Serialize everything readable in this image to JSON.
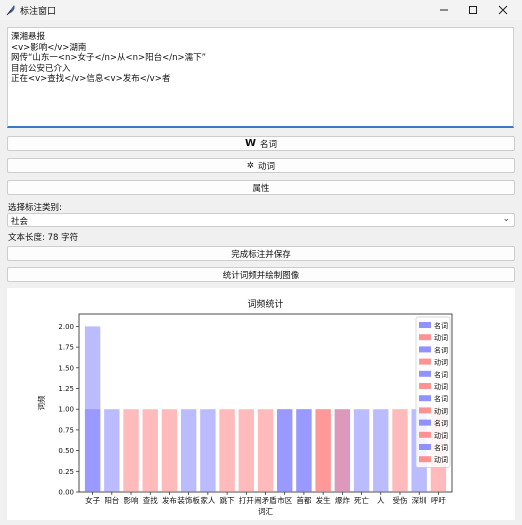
{
  "window": {
    "title": "标注窗口"
  },
  "editor": {
    "lines": [
      "溧湘悬报",
      "<v>影响</v>湖南",
      "网传“山东一<n>女子</n>从<n>阳台</n>濡下”",
      "目前公安已介入",
      "正在<v>查找</v>信息<v>发布</v>者"
    ]
  },
  "buttons": {
    "noun": {
      "icon": "W",
      "label": "名词"
    },
    "verb": {
      "icon": "✲",
      "label": "动词"
    },
    "attr": {
      "label": "属性"
    },
    "save": {
      "label": "完成标注并保存"
    },
    "stats": {
      "label": "统计词频并绘制图像"
    }
  },
  "category": {
    "label": "选择标注类别:",
    "selected": "社会"
  },
  "length": {
    "text": "文本长度: 78 字符"
  },
  "colors": {
    "noun": "#7777ff",
    "verb": "#ff7777"
  },
  "chart_data": {
    "type": "bar",
    "title": "词频统计",
    "xlabel": "词汇",
    "ylabel": "词频",
    "ylim": [
      0,
      2.15
    ],
    "yticks": [
      "0.00",
      "0.25",
      "0.50",
      "0.75",
      "1.00",
      "1.25",
      "1.50",
      "1.75",
      "2.00"
    ],
    "categories": [
      "女子",
      "阳台",
      "影响",
      "查找",
      "发布",
      "装饰板",
      "家人",
      "跳下",
      "打开",
      "闹矛盾",
      "市区",
      "首都",
      "发生",
      "爆炸",
      "死亡",
      "人",
      "受伤",
      "深圳",
      "呼吁"
    ],
    "bars": [
      {
        "cat": "女子",
        "layers": [
          {
            "pos": "n",
            "value": 2.0
          },
          {
            "pos": "n",
            "value": 1.0
          }
        ]
      },
      {
        "cat": "阳台",
        "layers": [
          {
            "pos": "n",
            "value": 1.0
          }
        ]
      },
      {
        "cat": "影响",
        "layers": [
          {
            "pos": "v",
            "value": 1.0
          }
        ]
      },
      {
        "cat": "查找",
        "layers": [
          {
            "pos": "v",
            "value": 1.0
          }
        ]
      },
      {
        "cat": "发布",
        "layers": [
          {
            "pos": "v",
            "value": 1.0
          }
        ]
      },
      {
        "cat": "装饰板",
        "layers": [
          {
            "pos": "n",
            "value": 1.0
          }
        ]
      },
      {
        "cat": "家人",
        "layers": [
          {
            "pos": "n",
            "value": 1.0
          }
        ]
      },
      {
        "cat": "跳下",
        "layers": [
          {
            "pos": "v",
            "value": 1.0
          }
        ]
      },
      {
        "cat": "打开",
        "layers": [
          {
            "pos": "v",
            "value": 1.0
          }
        ]
      },
      {
        "cat": "闹矛盾",
        "layers": [
          {
            "pos": "v",
            "value": 1.0
          }
        ]
      },
      {
        "cat": "市区",
        "layers": [
          {
            "pos": "n",
            "value": 1.0
          },
          {
            "pos": "n",
            "value": 1.0
          }
        ]
      },
      {
        "cat": "首都",
        "layers": [
          {
            "pos": "n",
            "value": 1.0
          },
          {
            "pos": "n",
            "value": 1.0
          }
        ]
      },
      {
        "cat": "发生",
        "layers": [
          {
            "pos": "v",
            "value": 1.0
          },
          {
            "pos": "v",
            "value": 1.0
          }
        ]
      },
      {
        "cat": "爆炸",
        "layers": [
          {
            "pos": "n",
            "value": 1.0
          },
          {
            "pos": "v",
            "value": 1.0
          }
        ]
      },
      {
        "cat": "死亡",
        "layers": [
          {
            "pos": "n",
            "value": 1.0
          }
        ]
      },
      {
        "cat": "人",
        "layers": [
          {
            "pos": "n",
            "value": 1.0
          }
        ]
      },
      {
        "cat": "受伤",
        "layers": [
          {
            "pos": "v",
            "value": 1.0
          }
        ]
      },
      {
        "cat": "深圳",
        "layers": [
          {
            "pos": "n",
            "value": 1.0
          }
        ]
      },
      {
        "cat": "呼吁",
        "layers": [
          {
            "pos": "v",
            "value": 1.0
          }
        ]
      }
    ],
    "legend": {
      "placement": "top-right",
      "entries": [
        {
          "name": "名词",
          "pos": "n"
        },
        {
          "name": "动词",
          "pos": "v"
        },
        {
          "name": "名词",
          "pos": "n"
        },
        {
          "name": "动词",
          "pos": "v"
        },
        {
          "name": "名词",
          "pos": "n"
        },
        {
          "name": "动词",
          "pos": "v"
        },
        {
          "name": "名词",
          "pos": "n"
        },
        {
          "name": "动词",
          "pos": "v"
        },
        {
          "name": "名词",
          "pos": "n"
        },
        {
          "name": "动词",
          "pos": "v"
        },
        {
          "name": "名词",
          "pos": "n"
        },
        {
          "name": "动词",
          "pos": "v"
        }
      ]
    }
  }
}
